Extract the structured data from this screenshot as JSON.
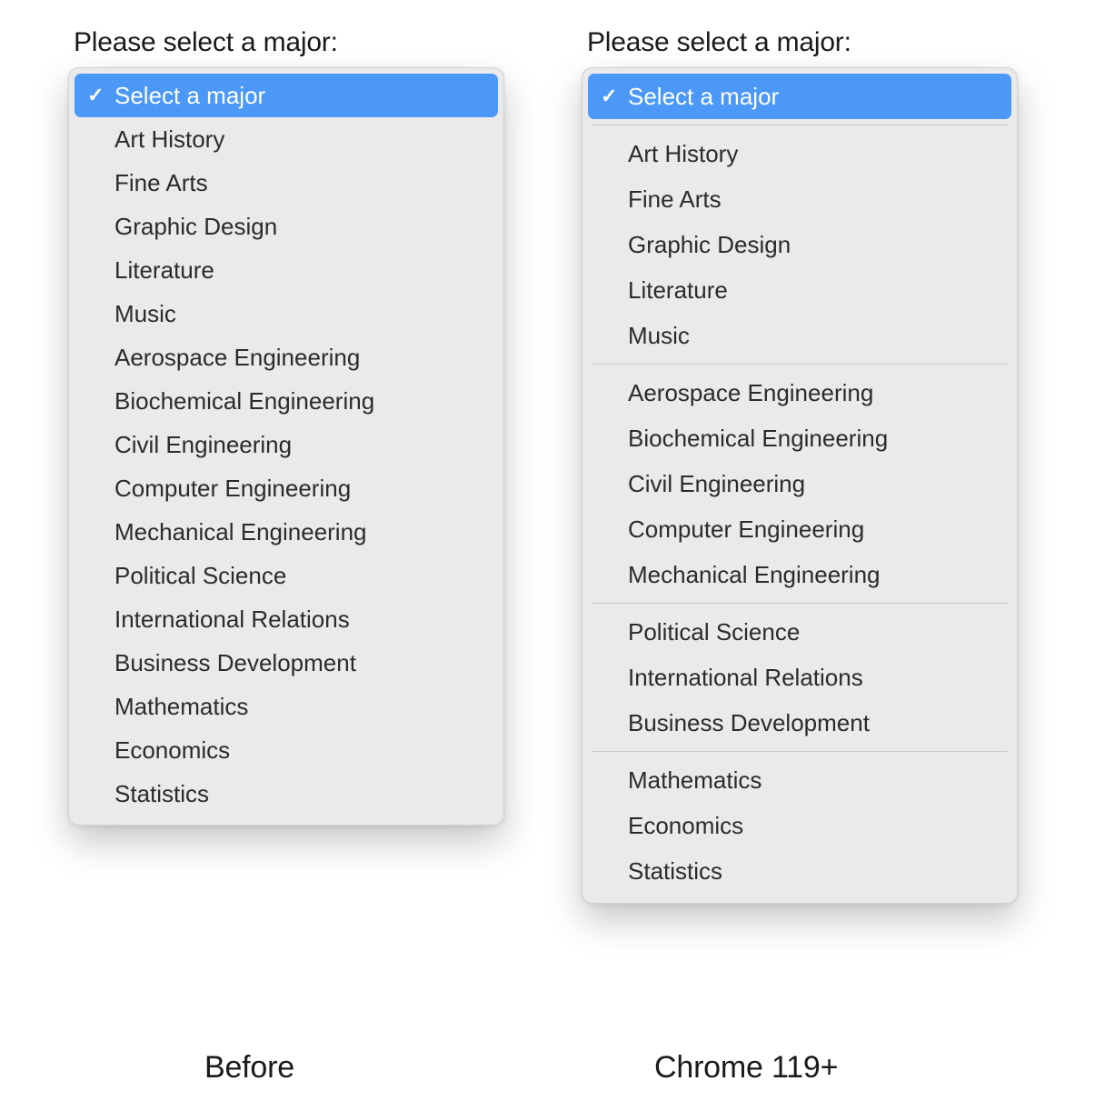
{
  "prompt": "Please select a major:",
  "selected_label": "Select a major",
  "captions": {
    "before": "Before",
    "after": "Chrome 119+"
  },
  "left": {
    "items": [
      "Select a major",
      "Art History",
      "Fine Arts",
      "Graphic Design",
      "Literature",
      "Music",
      "Aerospace Engineering",
      "Biochemical Engineering",
      "Civil Engineering",
      "Computer Engineering",
      "Mechanical Engineering",
      "Political Science",
      "International Relations",
      "Business Development",
      "Mathematics",
      "Economics",
      "Statistics"
    ]
  },
  "right": {
    "groups": [
      [
        "Select a major"
      ],
      [
        "Art History",
        "Fine Arts",
        "Graphic Design",
        "Literature",
        "Music"
      ],
      [
        "Aerospace Engineering",
        "Biochemical Engineering",
        "Civil Engineering",
        "Computer Engineering",
        "Mechanical Engineering"
      ],
      [
        "Political Science",
        "International Relations",
        "Business Development"
      ],
      [
        "Mathematics",
        "Economics",
        "Statistics"
      ]
    ]
  }
}
